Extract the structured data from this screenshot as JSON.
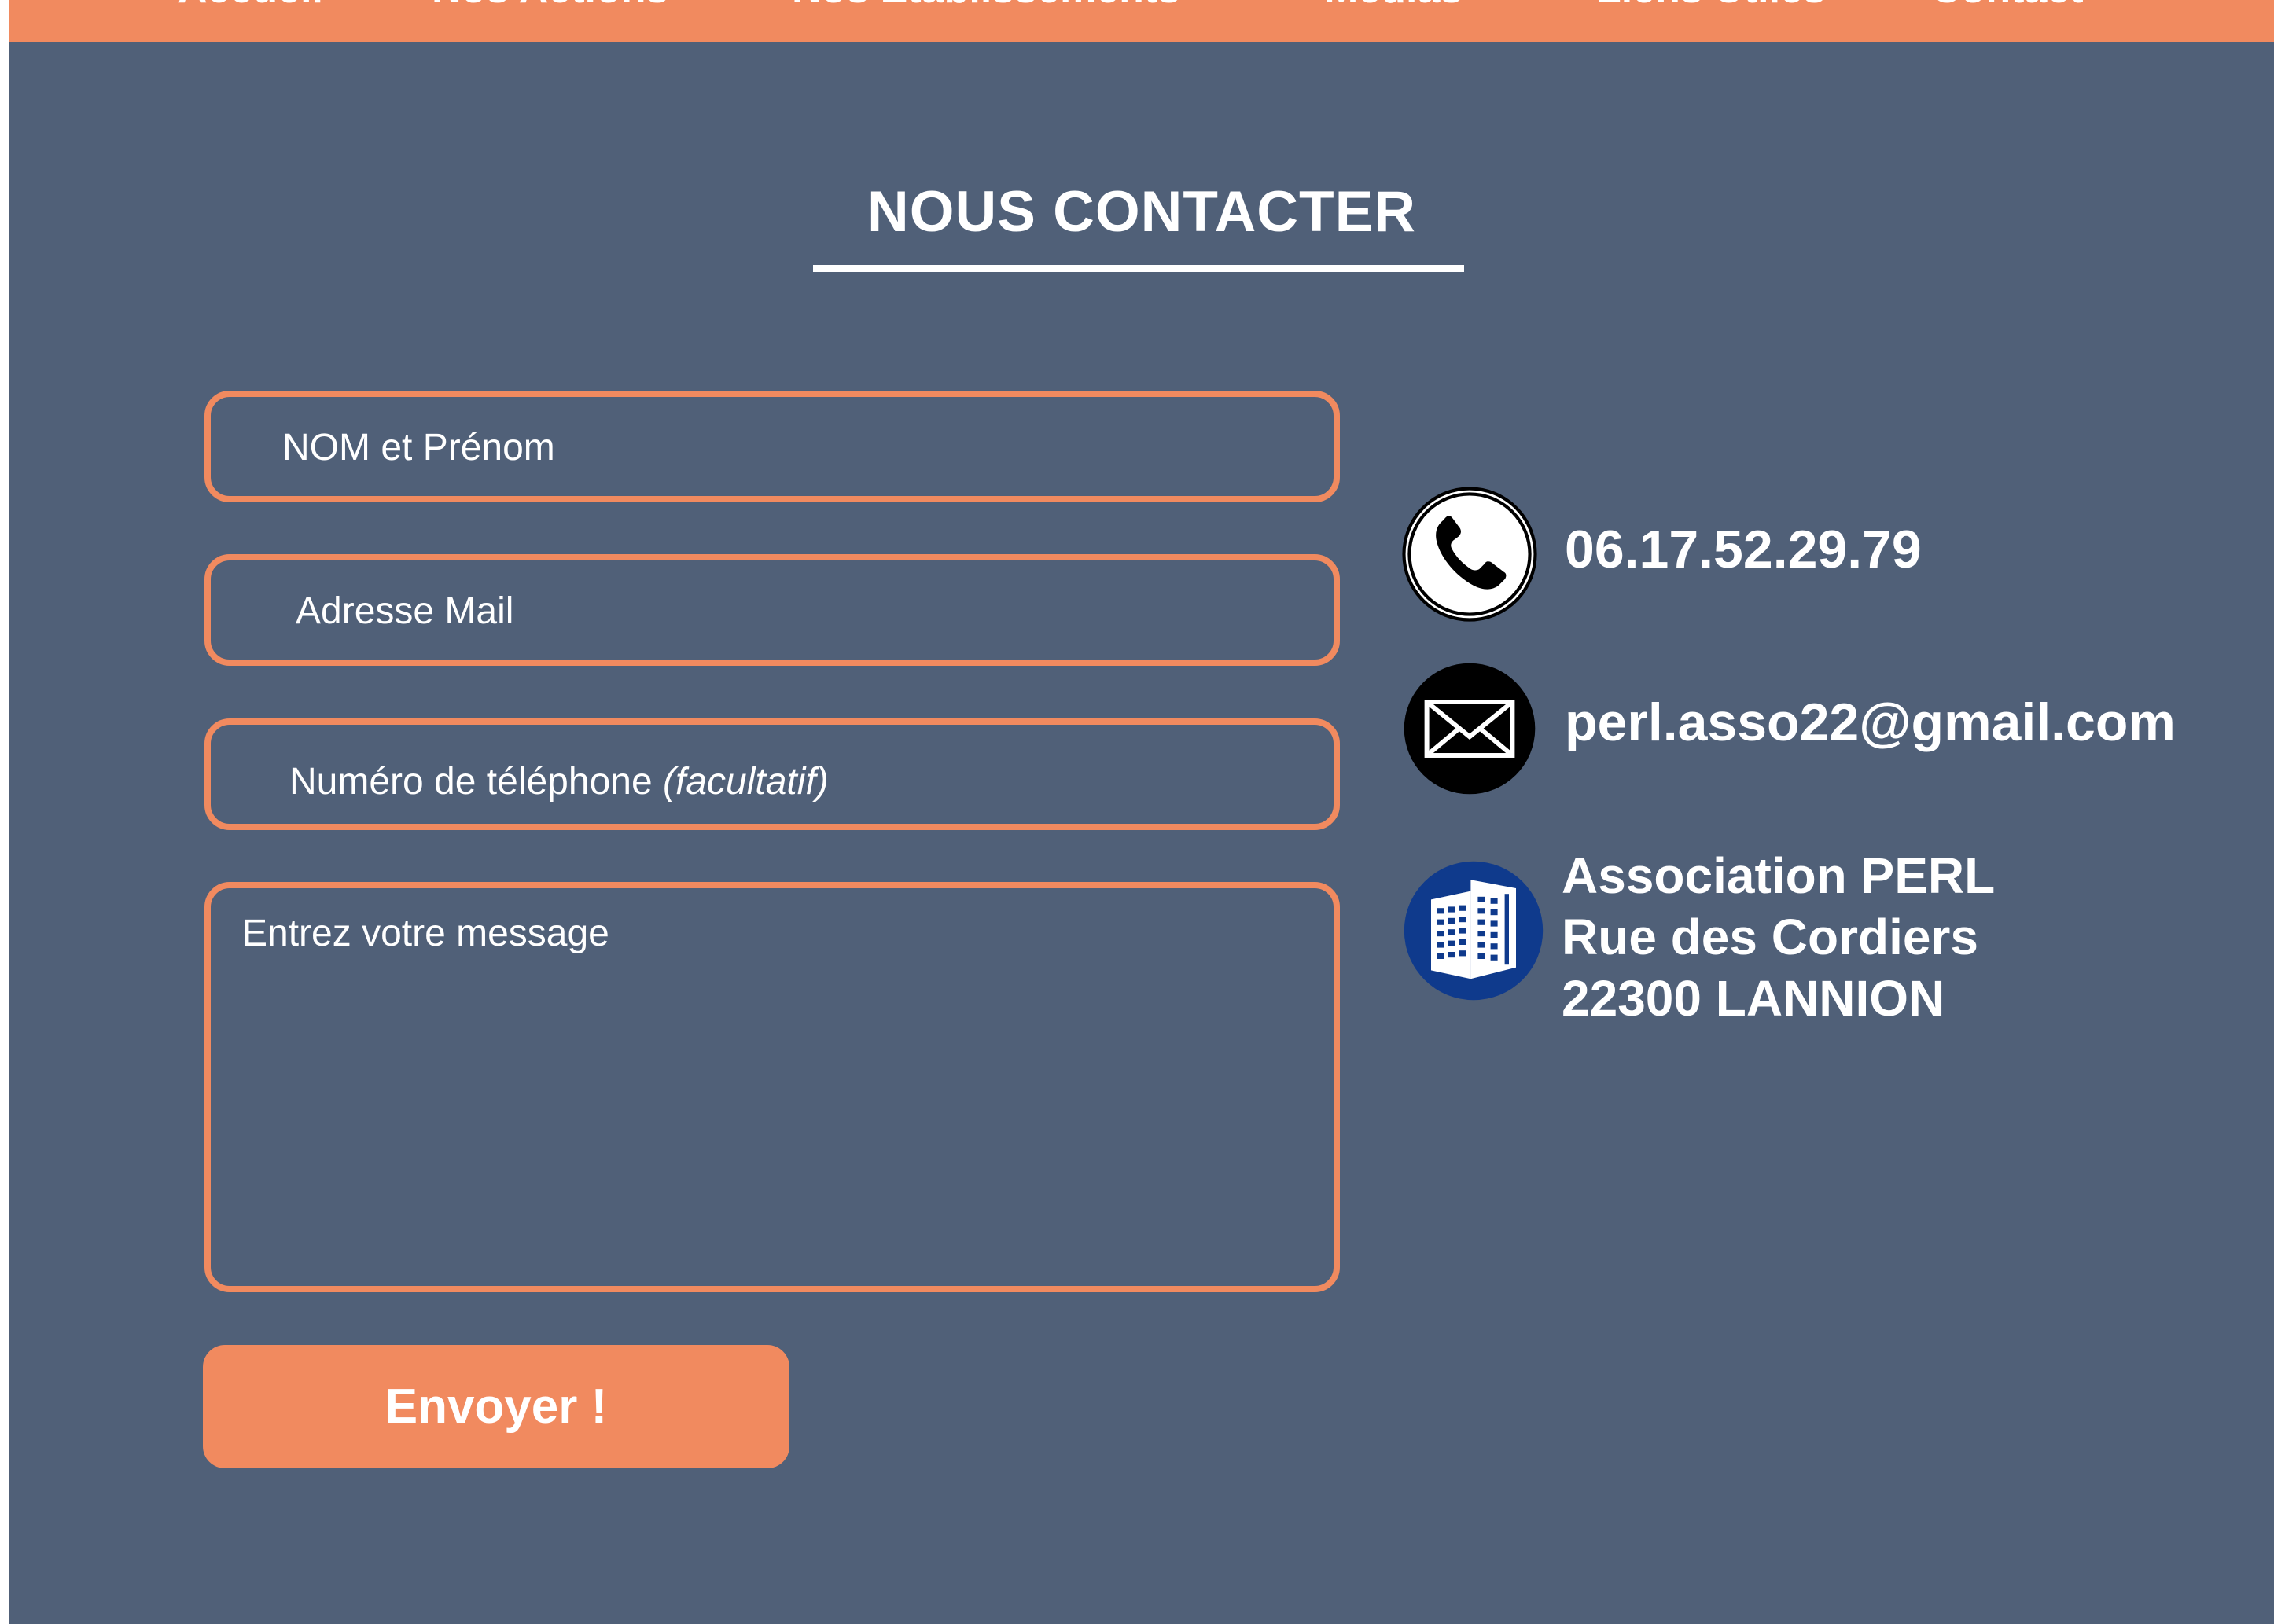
{
  "navbar": {
    "items": [
      {
        "label": "Accueil"
      },
      {
        "label": "Nos Actions"
      },
      {
        "label": "Nos Etablissements"
      },
      {
        "label": "Médias"
      },
      {
        "label": "Liens Utiles"
      },
      {
        "label": "Contact"
      }
    ]
  },
  "page_title": "NOUS CONTACTER",
  "form": {
    "name_placeholder": "NOM et Prénom",
    "email_placeholder": "Adresse Mail",
    "phone_placeholder": "Numéro de téléphone",
    "phone_optional": "(facultatif)",
    "message_placeholder": "Entrez votre message",
    "submit_label": "Envoyer !"
  },
  "contact": {
    "phone": "06.17.52.29.79",
    "email": "perl.asso22@gmail.com",
    "address": {
      "line1": "Association PERL",
      "line2": "Rue des Cordiers",
      "line3": "22300 LANNION"
    }
  },
  "icons": {
    "phone": "phone-icon",
    "mail": "envelope-icon",
    "address": "building-icon"
  },
  "colors": {
    "background": "#506078",
    "accent": "#f18a5f",
    "text": "#ffffff",
    "building_badge": "#0f3a8c"
  }
}
